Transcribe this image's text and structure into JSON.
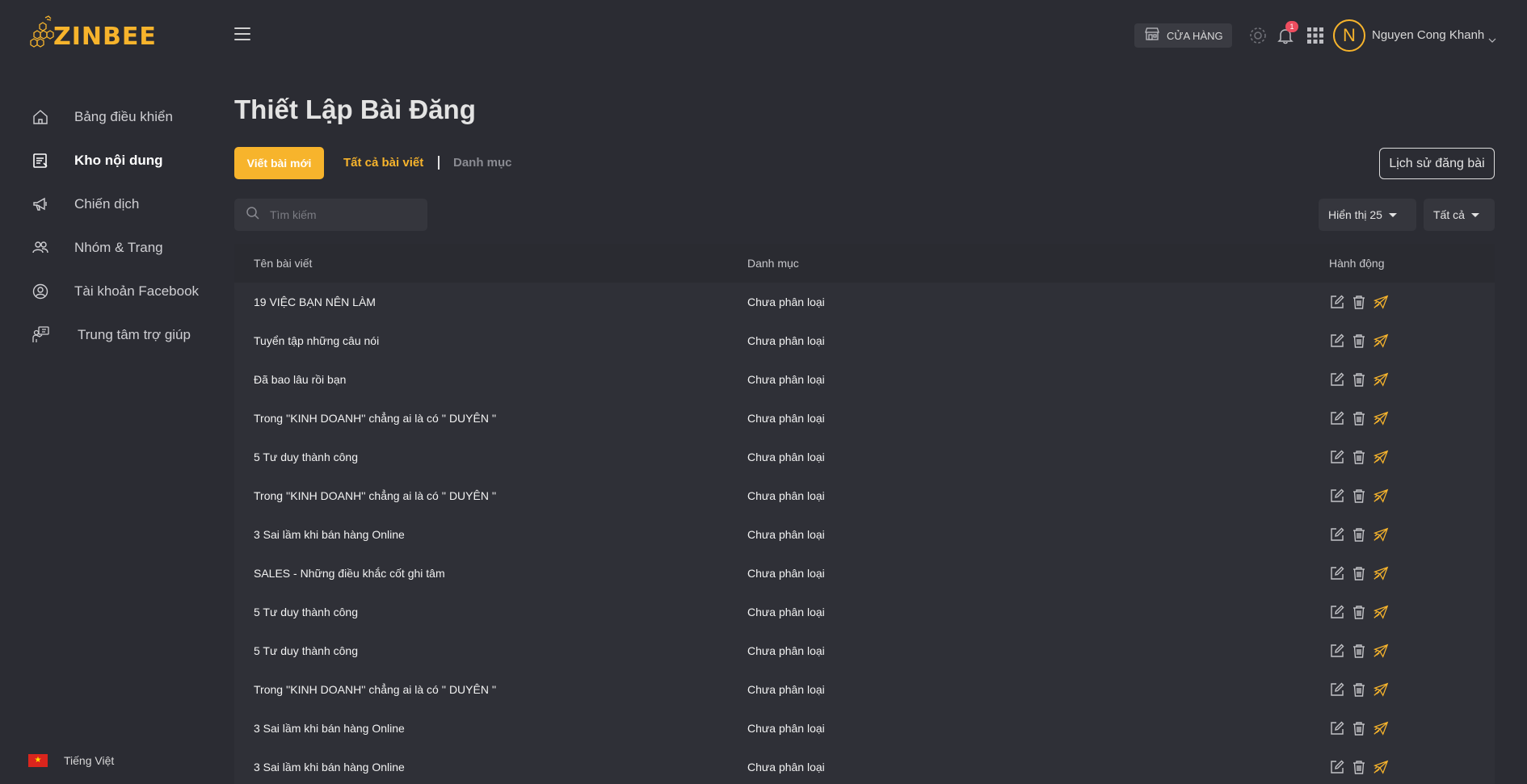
{
  "brand": {
    "name": "ZINBEE",
    "accent": "#f7b42c"
  },
  "sidebar": {
    "items": [
      {
        "label": "Bảng điều khiển",
        "icon": "home-icon",
        "active": false
      },
      {
        "label": "Kho nội dung",
        "icon": "content-icon",
        "active": true
      },
      {
        "label": "Chiến dịch",
        "icon": "megaphone-icon",
        "active": false
      },
      {
        "label": "Nhóm & Trang",
        "icon": "group-icon",
        "active": false
      },
      {
        "label": "Tài khoản Facebook",
        "icon": "user-circle-icon",
        "active": false
      },
      {
        "label": "Trung tâm trợ giúp",
        "icon": "help-center-icon",
        "active": false
      }
    ],
    "language": {
      "label": "Tiếng Việt",
      "flag": "vietnam-flag-icon"
    }
  },
  "topbar": {
    "store_label": "CỬA HÀNG",
    "notification_count": "1",
    "user": {
      "initial": "N",
      "name": "Nguyen Cong Khanh"
    }
  },
  "main": {
    "title": "Thiết Lập Bài Đăng",
    "new_post_label": "Viết bài mới",
    "tabs": {
      "all": "Tất cả bài viết",
      "category": "Danh mục"
    },
    "history_label": "Lịch sử đăng bài",
    "search_placeholder": "Tìm kiếm",
    "page_size_label": "Hiển thị 25",
    "filter_label": "Tất cả"
  },
  "table": {
    "headers": {
      "title": "Tên bài viết",
      "category": "Danh mục",
      "actions": "Hành động"
    },
    "rows": [
      {
        "title": "19 VIỆC BẠN NÊN LÀM",
        "category": "Chưa phân loại"
      },
      {
        "title": "Tuyển tập những câu nói",
        "category": "Chưa phân loại"
      },
      {
        "title": "Đã bao lâu rồi bạn",
        "category": "Chưa phân loại"
      },
      {
        "title": "Trong ''KINH DOANH'' chẳng ai là có '' DUYÊN ''",
        "category": "Chưa phân loại"
      },
      {
        "title": "5 Tư duy thành công",
        "category": "Chưa phân loại"
      },
      {
        "title": "Trong ''KINH DOANH'' chẳng ai là có '' DUYÊN ''",
        "category": "Chưa phân loại"
      },
      {
        "title": "3 Sai lầm khi bán hàng Online",
        "category": "Chưa phân loại"
      },
      {
        "title": "SALES - Những điều khắc cốt ghi tâm",
        "category": "Chưa phân loại"
      },
      {
        "title": "5 Tư duy thành công",
        "category": "Chưa phân loại"
      },
      {
        "title": "5 Tư duy thành công",
        "category": "Chưa phân loại"
      },
      {
        "title": "Trong ''KINH DOANH'' chẳng ai là có '' DUYÊN ''",
        "category": "Chưa phân loại"
      },
      {
        "title": "3 Sai lầm khi bán hàng Online",
        "category": "Chưa phân loại"
      },
      {
        "title": "3 Sai lầm khi bán hàng Online",
        "category": "Chưa phân loại"
      }
    ]
  }
}
